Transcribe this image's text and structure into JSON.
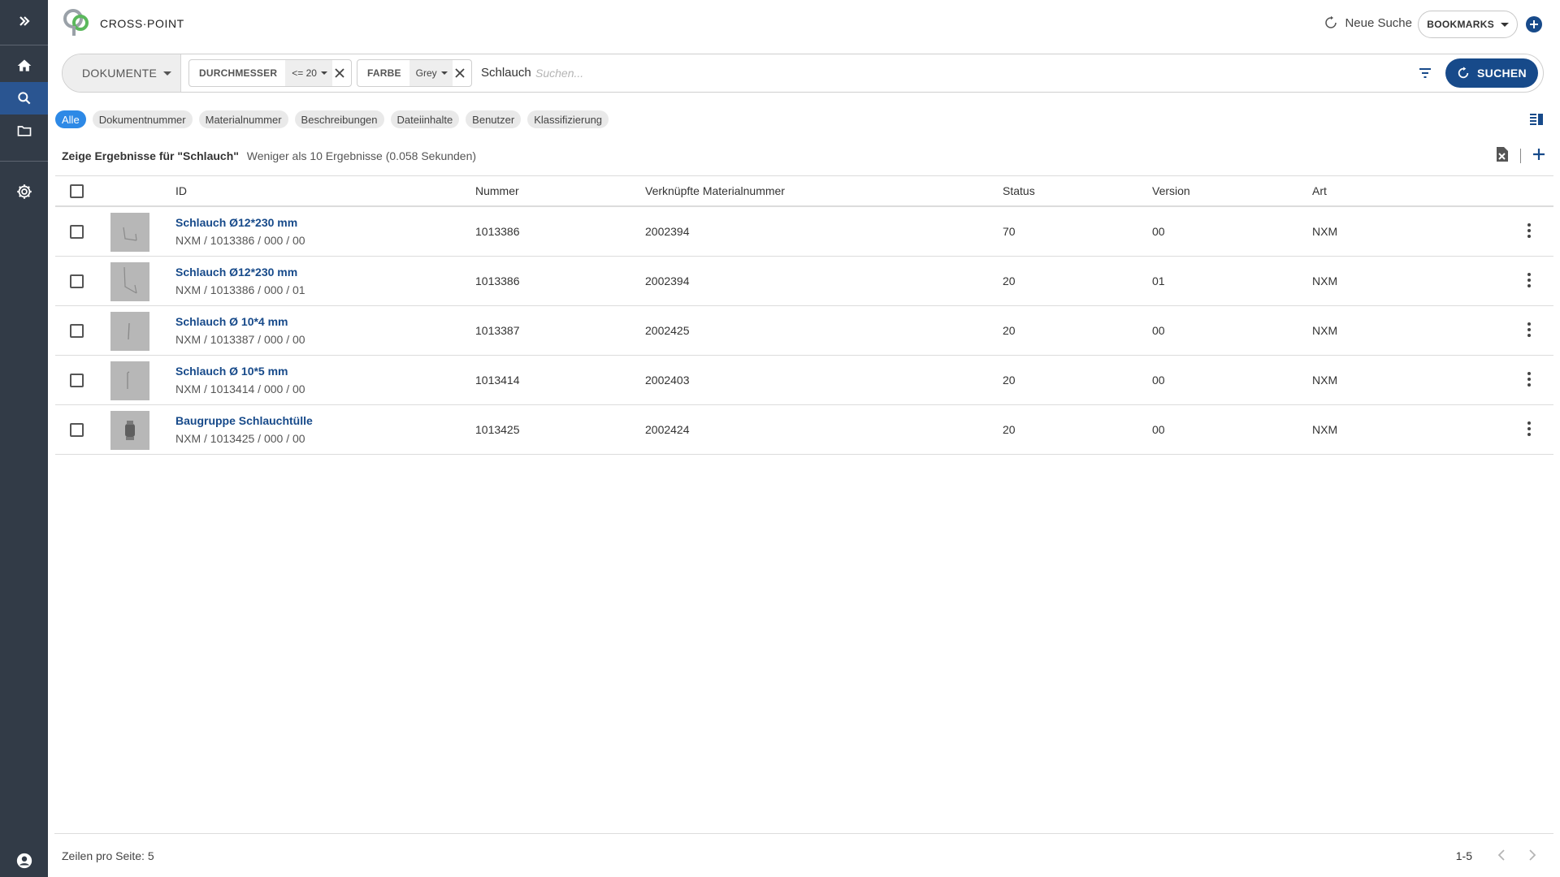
{
  "app": {
    "brand": "CROSS·POINT"
  },
  "header": {
    "new_search_label": "Neue Suche",
    "bookmarks_label": "BOOKMARKS"
  },
  "search": {
    "doc_type": "DOKUMENTE",
    "filters": [
      {
        "key": "DURCHMESSER",
        "value": "<= 20"
      },
      {
        "key": "FARBE",
        "value": "Grey"
      }
    ],
    "query": "Schlauch",
    "placeholder": "Suchen...",
    "submit_label": "SUCHEN"
  },
  "scope_tabs": [
    {
      "label": "Alle",
      "active": true
    },
    {
      "label": "Dokumentnummer",
      "active": false
    },
    {
      "label": "Materialnummer",
      "active": false
    },
    {
      "label": "Beschreibungen",
      "active": false
    },
    {
      "label": "Dateiinhalte",
      "active": false
    },
    {
      "label": "Benutzer",
      "active": false
    },
    {
      "label": "Klassifizierung",
      "active": false
    }
  ],
  "results": {
    "heading": "Zeige Ergebnisse für \"Schlauch\"",
    "meta": "Weniger als 10 Ergebnisse (0.058 Sekunden)"
  },
  "table": {
    "columns": {
      "id": "ID",
      "nummer": "Nummer",
      "material": "Verknüpfte Materialnummer",
      "status": "Status",
      "version": "Version",
      "art": "Art"
    },
    "rows": [
      {
        "title": "Schlauch Ø12*230 mm",
        "sub": "NXM / 1013386 / 000 / 00",
        "nummer": "1013386",
        "material": "2002394",
        "status": "70",
        "version": "00",
        "art": "NXM"
      },
      {
        "title": "Schlauch Ø12*230 mm",
        "sub": "NXM / 1013386 / 000 / 01",
        "nummer": "1013386",
        "material": "2002394",
        "status": "20",
        "version": "01",
        "art": "NXM"
      },
      {
        "title": "Schlauch Ø 10*4 mm",
        "sub": "NXM / 1013387 / 000 / 00",
        "nummer": "1013387",
        "material": "2002425",
        "status": "20",
        "version": "00",
        "art": "NXM"
      },
      {
        "title": "Schlauch Ø 10*5 mm",
        "sub": "NXM / 1013414 / 000 / 00",
        "nummer": "1013414",
        "material": "2002403",
        "status": "20",
        "version": "00",
        "art": "NXM"
      },
      {
        "title": "Baugruppe Schlauchtülle",
        "sub": "NXM / 1013425 / 000 / 00",
        "nummer": "1013425",
        "material": "2002424",
        "status": "20",
        "version": "00",
        "art": "NXM"
      }
    ]
  },
  "footer": {
    "rows_per_page": "Zeilen pro Seite: 5",
    "range": "1-5"
  },
  "icons": {
    "sidebar": [
      "double-chevron-right-icon",
      "home-icon",
      "search-icon",
      "folder-icon",
      "gear-icon",
      "account-circle-icon"
    ],
    "header": [
      "refresh-icon",
      "caret-down-icon",
      "plus-circle-icon"
    ],
    "toolbar": [
      "filter-lines-icon",
      "view-columns-icon",
      "excel-export-icon",
      "plus-icon",
      "chevron-left-icon",
      "chevron-right-icon"
    ]
  },
  "colors": {
    "sidebar": "#323b47",
    "sidebar_active": "#2a5591",
    "primary": "#174a8a",
    "accent_pill": "#2d89e6",
    "logo_green": "#5bb85c",
    "logo_grey": "#9aa1a8"
  }
}
